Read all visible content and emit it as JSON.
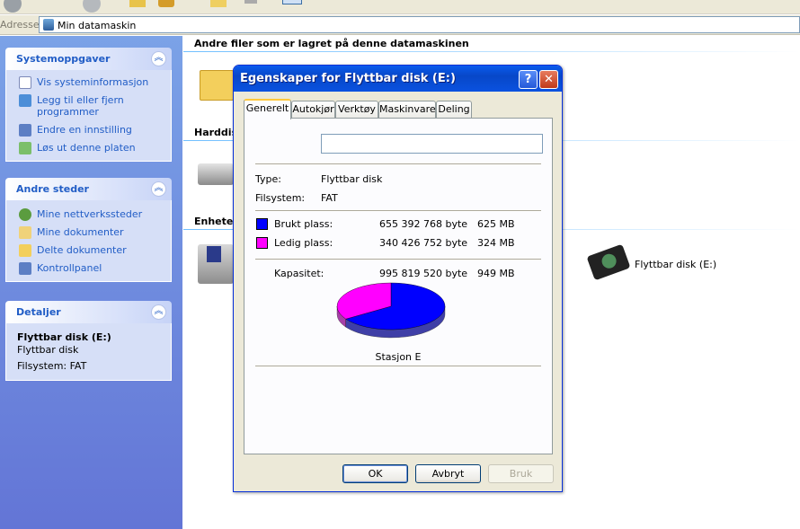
{
  "address": {
    "label": "Adresse",
    "value": "Min datamaskin"
  },
  "taskpane": {
    "system_tasks": {
      "title": "Systemoppgaver",
      "items": [
        {
          "label": "Vis systeminformasjon",
          "icon": "system-info-icon"
        },
        {
          "label": "Legg til eller fjern programmer",
          "icon": "add-remove-programs-icon"
        },
        {
          "label": "Endre en innstilling",
          "icon": "control-setting-icon"
        },
        {
          "label": "Løs ut denne platen",
          "icon": "eject-icon"
        }
      ]
    },
    "other_places": {
      "title": "Andre steder",
      "items": [
        {
          "label": "Mine nettverkssteder",
          "icon": "network-places-icon"
        },
        {
          "label": "Mine dokumenter",
          "icon": "my-documents-icon"
        },
        {
          "label": "Delte dokumenter",
          "icon": "shared-documents-icon"
        },
        {
          "label": "Kontrollpanel",
          "icon": "control-panel-icon"
        }
      ]
    },
    "details": {
      "title": "Detaljer",
      "name": "Flyttbar disk (E:)",
      "type": "Flyttbar disk",
      "filesystem": "Filsystem: FAT"
    }
  },
  "content": {
    "title": "Andre filer som er lagret på denne datamaskinen",
    "section_harddisks": "Harddis",
    "section_devices": "Enheter",
    "device_label": "Flyttbar disk (E:)"
  },
  "dialog": {
    "title": "Egenskaper for Flyttbar disk (E:)",
    "help_label": "?",
    "close_label": "✕",
    "tabs": [
      "Generelt",
      "Autokjør",
      "Verktøy",
      "Maskinvare",
      "Deling"
    ],
    "name_value": "",
    "type_label": "Type:",
    "type_value": "Flyttbar disk",
    "fs_label": "Filsystem:",
    "fs_value": "FAT",
    "used": {
      "label": "Brukt plass:",
      "bytes": "655 392 768 byte",
      "size": "625 MB",
      "color": "#0000ff"
    },
    "free": {
      "label": "Ledig plass:",
      "bytes": "340 426 752 byte",
      "size": "324 MB",
      "color": "#ff00ff"
    },
    "capacity": {
      "label": "Kapasitet:",
      "bytes": "995 819 520 byte",
      "size": "949 MB"
    },
    "used_fraction": 0.658,
    "drive_label": "Stasjon E",
    "ok_label": "OK",
    "cancel_label": "Avbryt",
    "apply_label": "Bruk"
  }
}
